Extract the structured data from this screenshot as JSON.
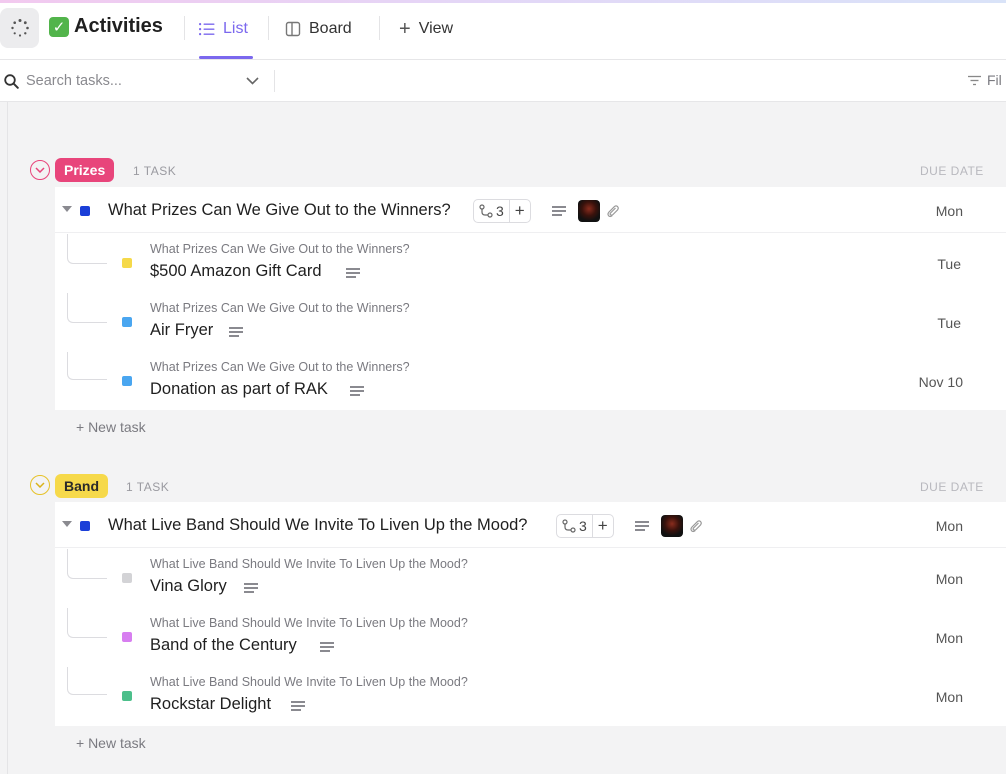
{
  "header": {
    "title": "Activities",
    "tabs": [
      {
        "label": "List",
        "active": true
      },
      {
        "label": "Board",
        "active": false
      }
    ],
    "add_view_label": "View"
  },
  "search": {
    "placeholder": "Search tasks...",
    "filter_label": "Fil"
  },
  "colors": {
    "accent": "#7b68ee",
    "prizes": "#e8457b",
    "band": "#f6d94a"
  },
  "groups": [
    {
      "name": "Prizes",
      "count_label": "1 TASK",
      "due_header": "DUE DATE",
      "new_task_label": "+ New task",
      "task": {
        "name": "What Prizes Can We Give Out to the Winners?",
        "subtask_count": "3",
        "add_label": "+",
        "due": "Mon",
        "status_color": "#1b3fd8",
        "subtasks": [
          {
            "parent": "What Prizes Can We Give Out to the Winners?",
            "name": "$500 Amazon Gift Card",
            "due": "Tue",
            "status_color": "#f5d94a"
          },
          {
            "parent": "What Prizes Can We Give Out to the Winners?",
            "name": "Air Fryer",
            "due": "Tue",
            "status_color": "#4aa6f0"
          },
          {
            "parent": "What Prizes Can We Give Out to the Winners?",
            "name": "Donation as part of RAK",
            "due": "Nov 10",
            "status_color": "#4aa6f0"
          }
        ]
      }
    },
    {
      "name": "Band",
      "count_label": "1 TASK",
      "due_header": "DUE DATE",
      "new_task_label": "+ New task",
      "task": {
        "name": "What Live Band Should We Invite To Liven Up the Mood?",
        "subtask_count": "3",
        "add_label": "+",
        "due": "Mon",
        "status_color": "#1b3fd8",
        "subtasks": [
          {
            "parent": "What Live Band Should We Invite To Liven Up the Mood?",
            "name": "Vina Glory",
            "due": "Mon",
            "status_color": "#d3d3d6"
          },
          {
            "parent": "What Live Band Should We Invite To Liven Up the Mood?",
            "name": "Band of the Century",
            "due": "Mon",
            "status_color": "#d77ef0"
          },
          {
            "parent": "What Live Band Should We Invite To Liven Up the Mood?",
            "name": "Rockstar Delight",
            "due": "Mon",
            "status_color": "#4cbf8b"
          }
        ]
      }
    }
  ]
}
